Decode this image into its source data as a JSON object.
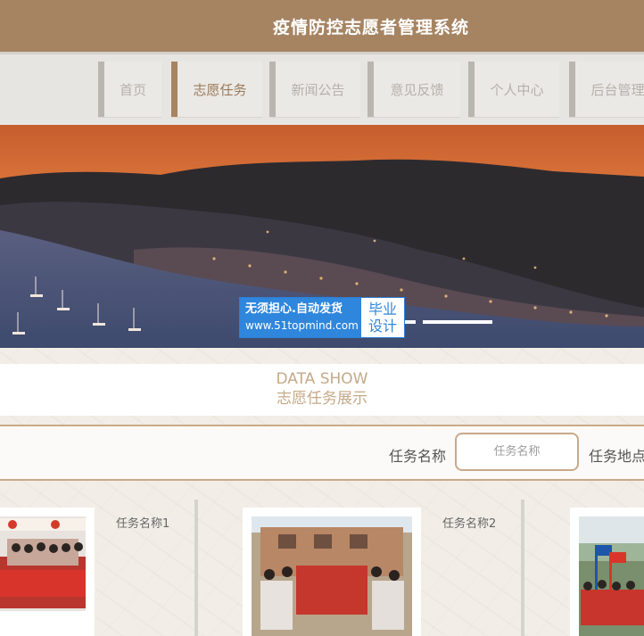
{
  "header": {
    "title": "疫情防控志愿者管理系统"
  },
  "nav": {
    "items": [
      {
        "label": "首页"
      },
      {
        "label": "志愿任务"
      },
      {
        "label": "新闻公告"
      },
      {
        "label": "意见反馈"
      },
      {
        "label": "个人中心"
      },
      {
        "label": "后台管理"
      }
    ],
    "active_index": 1
  },
  "banner": {
    "badge_line1": "无须担心.自动发货",
    "badge_line2": "www.51topmind.com",
    "badge_right1": "毕业",
    "badge_right2": "设计"
  },
  "section": {
    "title_en": "DATA SHOW",
    "title_cn": "志愿任务展示"
  },
  "search": {
    "name_label": "任务名称",
    "name_placeholder": "任务名称",
    "location_label": "任务地点"
  },
  "cards": [
    {
      "name": "任务名称1"
    },
    {
      "name": "任务名称2"
    },
    {
      "name": ""
    }
  ],
  "colors": {
    "header": "#a68462",
    "accent": "#c8a98a",
    "badge_blue": "#2f86dd"
  }
}
